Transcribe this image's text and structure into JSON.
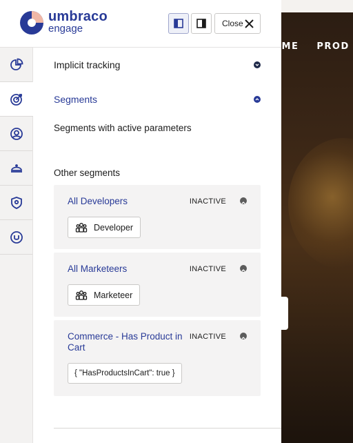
{
  "background_site": {
    "nav_items": [
      "OME",
      "PROD"
    ]
  },
  "header": {
    "logo_primary": "umbraco",
    "logo_secondary": "engage",
    "close_label": "Close",
    "brand_color": "#283a97",
    "accent_color": "#f0b7a6"
  },
  "sidebar": {
    "items": [
      {
        "icon": "pie-chart-icon",
        "active": false
      },
      {
        "icon": "target-icon",
        "active": true
      },
      {
        "icon": "user-circle-icon",
        "active": false
      },
      {
        "icon": "cloche-icon",
        "active": false
      },
      {
        "icon": "shield-pin-icon",
        "active": false
      },
      {
        "icon": "umbraco-logo-icon",
        "active": false
      }
    ]
  },
  "main": {
    "accordion": {
      "implicit_tracking": "Implicit tracking",
      "segments": "Segments"
    },
    "active_heading": "Segments with active parameters",
    "other_heading": "Other segments",
    "segments": [
      {
        "title": "All Developers",
        "status": "INACTIVE",
        "chip": "Developer"
      },
      {
        "title": "All Marketeers",
        "status": "INACTIVE",
        "chip": "Marketeer"
      },
      {
        "title": "Commerce - Has Product in Cart",
        "status": "INACTIVE",
        "chip": "{ \"HasProductsInCart\": true }"
      }
    ]
  }
}
